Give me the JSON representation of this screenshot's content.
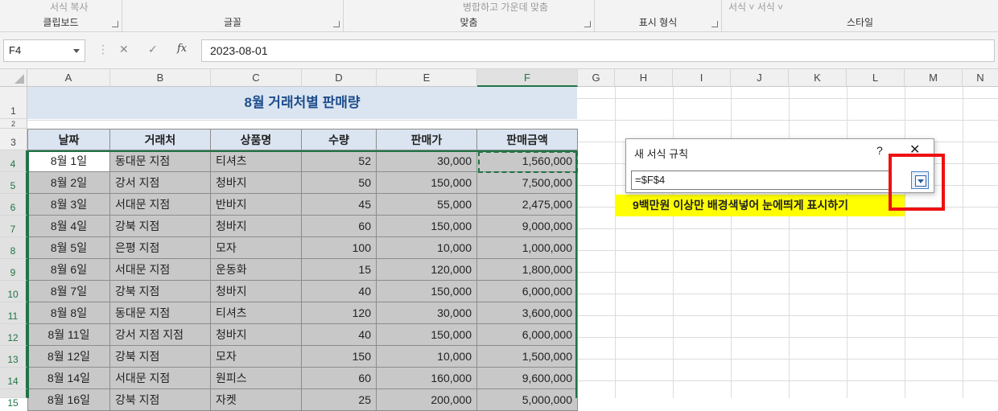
{
  "ribbon": {
    "groups": [
      {
        "label": "클립보드",
        "faint": "서식 복사"
      },
      {
        "label": "글꼴",
        "faint": ""
      },
      {
        "label": "맞춤",
        "faint": "병합하고 가운데 맞춤"
      },
      {
        "label": "표시 형식",
        "faint": ""
      },
      {
        "label": "스타일",
        "faint": "서식 ˅  서식 ˅"
      }
    ]
  },
  "formula_bar": {
    "name_box": "F4",
    "cancel_icon": "✕",
    "enter_icon": "✓",
    "fx_label": "fx",
    "value": "2023-08-01"
  },
  "columns": [
    "A",
    "B",
    "C",
    "D",
    "E",
    "F",
    "G",
    "H",
    "I",
    "J",
    "K",
    "L",
    "M",
    "N"
  ],
  "rows": [
    "1",
    "2",
    "3",
    "4",
    "5",
    "6",
    "7",
    "8",
    "9",
    "10",
    "11",
    "12",
    "13",
    "14",
    "15"
  ],
  "sheet": {
    "title": "8월 거래처별 판매량",
    "headers": [
      "날짜",
      "거래처",
      "상품명",
      "수량",
      "판매가",
      "판매금액"
    ],
    "data": [
      [
        "8월 1일",
        "동대문 지점",
        "티셔츠",
        "52",
        "30,000",
        "1,560,000"
      ],
      [
        "8월 2일",
        "강서 지점",
        "청바지",
        "50",
        "150,000",
        "7,500,000"
      ],
      [
        "8월 3일",
        "서대문 지점",
        "반바지",
        "45",
        "55,000",
        "2,475,000"
      ],
      [
        "8월 4일",
        "강북 지점",
        "청바지",
        "60",
        "150,000",
        "9,000,000"
      ],
      [
        "8월 5일",
        "은평 지점",
        "모자",
        "100",
        "10,000",
        "1,000,000"
      ],
      [
        "8월 6일",
        "서대문 지점",
        "운동화",
        "15",
        "120,000",
        "1,800,000"
      ],
      [
        "8월 7일",
        "강북 지점",
        "청바지",
        "40",
        "150,000",
        "6,000,000"
      ],
      [
        "8월 8일",
        "동대문 지점",
        "티셔츠",
        "120",
        "30,000",
        "3,600,000"
      ],
      [
        "8월 11일",
        "강서 지점 지점",
        "청바지",
        "40",
        "150,000",
        "6,000,000"
      ],
      [
        "8월 12일",
        "강북 지점",
        "모자",
        "150",
        "10,000",
        "1,500,000"
      ],
      [
        "8월 14일",
        "서대문 지점",
        "원피스",
        "60",
        "160,000",
        "9,600,000"
      ],
      [
        "8월 16일",
        "강북 지점",
        "자켓",
        "25",
        "200,000",
        "5,000,000"
      ]
    ]
  },
  "dialog": {
    "title": "새 서식 규칙",
    "help": "?",
    "close": "✕",
    "formula_value": "=$F$4"
  },
  "annotation": {
    "text": "9백만원 이상만 배경색넣어 눈에띄게 표시하기",
    "highlight_color": "#ffff00",
    "box_color": "#ee1111"
  },
  "colors": {
    "accent": "#217346",
    "header_fill": "#dbe5f1",
    "data_fill": "#c8c8c8",
    "title_text": "#1f4e8c"
  }
}
